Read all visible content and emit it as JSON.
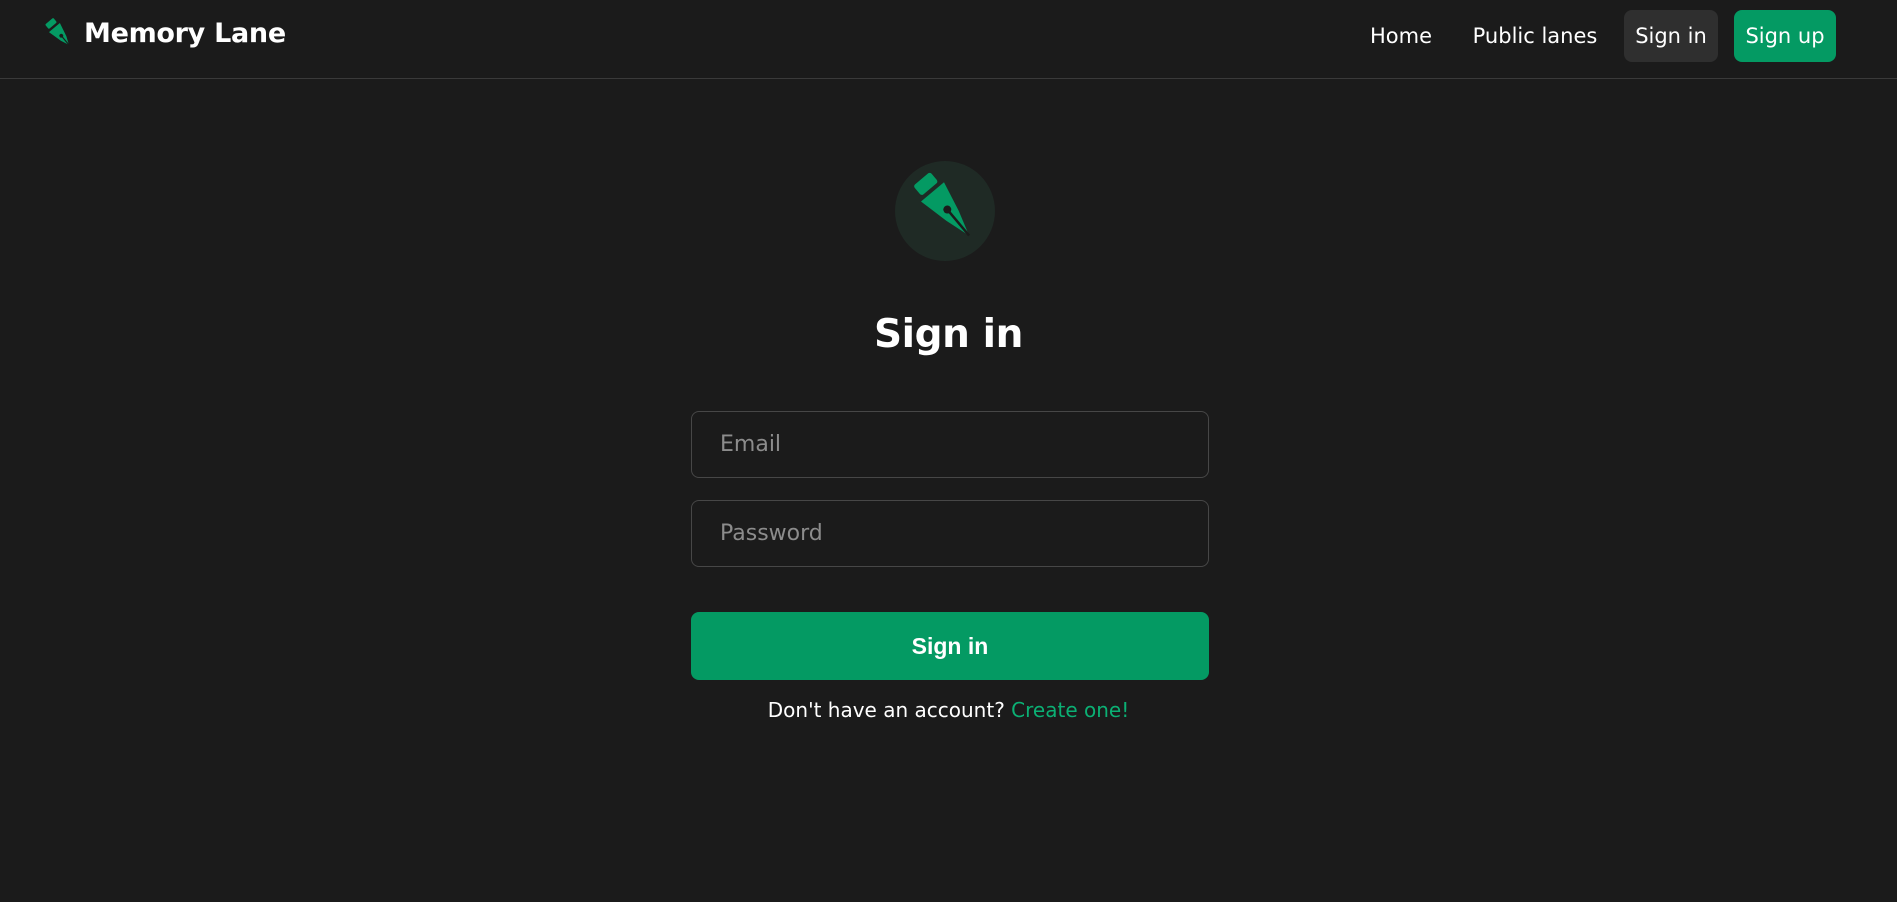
{
  "nav": {
    "brand": "Memory Lane",
    "links": {
      "home": "Home",
      "public_lanes": "Public lanes",
      "sign_in": "Sign in",
      "sign_up": "Sign up"
    },
    "brand_icon": "pen-nib-icon"
  },
  "main": {
    "logo_icon": "pen-nib-icon",
    "title": "Sign in",
    "email": {
      "placeholder": "Email",
      "value": ""
    },
    "password": {
      "placeholder": "Password",
      "value": ""
    },
    "submit_label": "Sign in",
    "no_account_text": "Don't have an account?",
    "create_link": "Create one!"
  },
  "colors": {
    "background": "#1b1b1b",
    "accent": "#049a63",
    "link": "#0bb074",
    "input_border": "#474747"
  }
}
